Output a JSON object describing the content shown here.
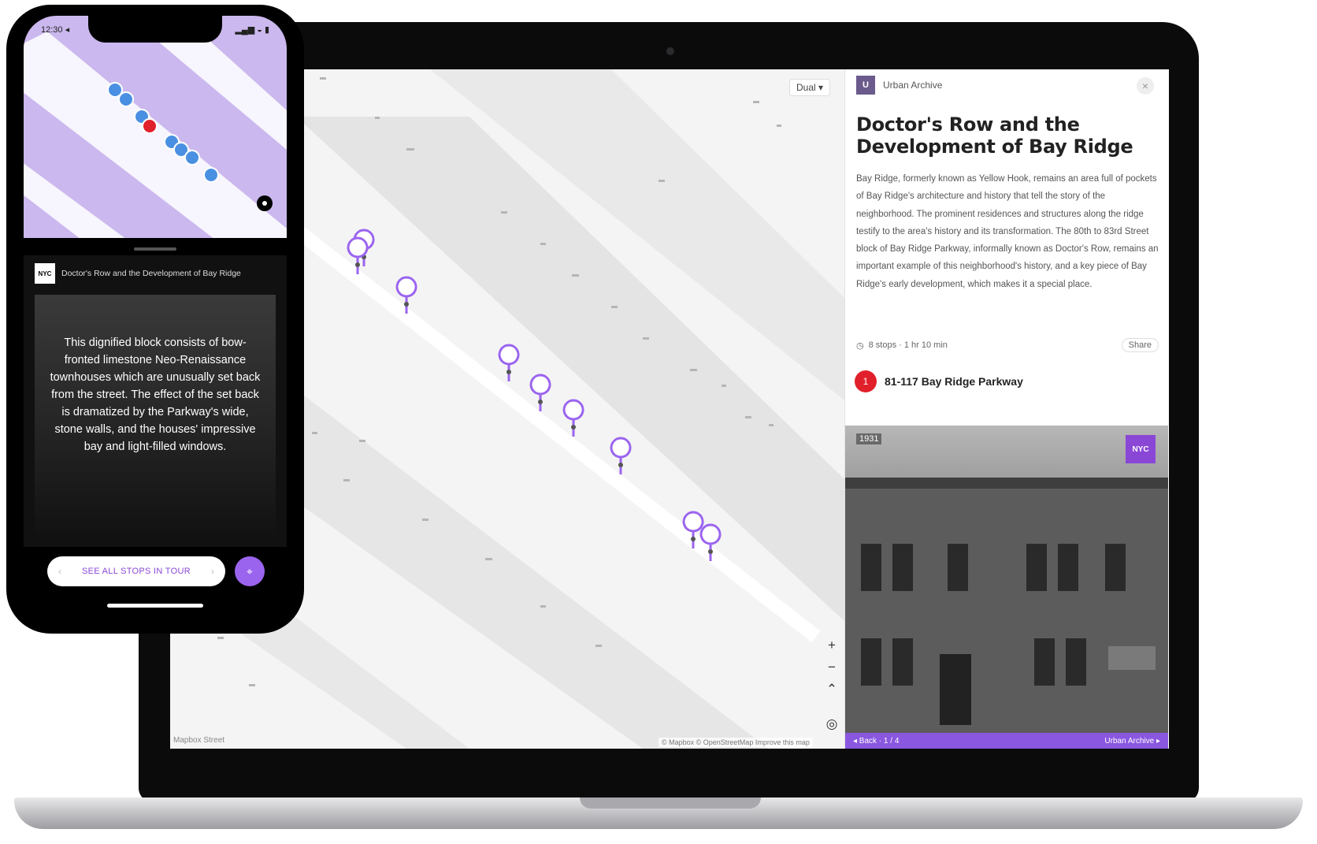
{
  "laptop": {
    "map": {
      "layer_select": "Dual ▾",
      "controls": {
        "zoom_in": "+",
        "zoom_out": "−",
        "north": "⌃",
        "locate": "◎"
      },
      "attribution": "© Mapbox © OpenStreetMap   Improve this map",
      "scale": "Mapbox Street"
    },
    "panel": {
      "header_logo": "U",
      "header_label": "Urban Archive",
      "close": "×",
      "title": "Doctor's Row and the Development of Bay Ridge",
      "description": "Bay Ridge, formerly known as Yellow Hook, remains an area full of pockets of Bay Ridge's architecture and history that tell the story of the neighborhood. The prominent residences and structures along the ridge testify to the area's history and its transformation. The 80th to 83rd Street block of Bay Ridge Parkway, informally known as Doctor's Row, remains an important example of this neighborhood's history, and a key piece of Bay Ridge's early development, which makes it a special place.",
      "meta_left": "8 stops · 1 hr 10 min",
      "meta_link": "Share",
      "stop_marker": "1",
      "stop_title": "81-117 Bay Ridge Parkway",
      "photo_year": "1931",
      "photo_badge": "NYC",
      "photo_strip_left": "◂ Back · 1 / 4",
      "photo_strip_right": "Urban Archive ▸"
    }
  },
  "phone": {
    "status_time": "12:30 ◂",
    "status_icons": "▂▄▆ ◒ ▮",
    "card_icon": "NYC",
    "card_title": "Doctor's Row and the Development of Bay Ridge",
    "card_text": "This dignified block consists of bow-fronted limestone Neo-Renaissance townhouses which are unusually set back from the street. The effect of the set back is dramatized by the Parkway's wide, stone walls, and the houses' impressive bay and light-filled windows.",
    "pill_label": "SEE ALL STOPS IN TOUR",
    "pill_arrow": "›",
    "fab_icon": "⌖"
  },
  "colors": {
    "accent": "#9b64ef",
    "marker_red": "#e0202a",
    "phone_map": "#cbb8ee",
    "marker_blue": "#4a90e2"
  }
}
